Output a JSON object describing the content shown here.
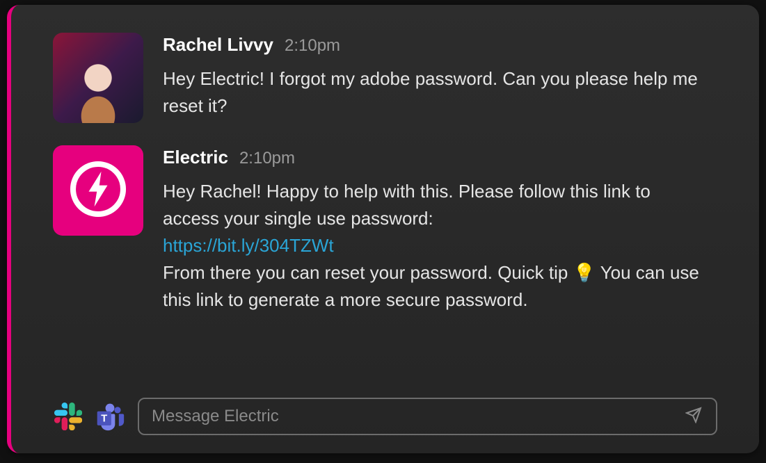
{
  "messages": [
    {
      "sender": "Rachel Livvy",
      "timestamp": "2:10pm",
      "avatar_kind": "user",
      "body": "Hey Electric! I forgot my adobe password. Can you please help me reset it?"
    },
    {
      "sender": "Electric",
      "timestamp": "2:10pm",
      "avatar_kind": "bot",
      "body_part1": "Hey Rachel! Happy to help with this. Please follow this link to access your single use password:",
      "link_text": "https://bit.ly/304TZWt",
      "body_part2": "From there you can reset your password. Quick tip ",
      "emoji": "💡",
      "body_part3": " You can use this link to generate a more secure password."
    }
  ],
  "composer": {
    "placeholder": "Message Electric"
  },
  "icons": {
    "slack": "slack-icon",
    "teams": "teams-icon",
    "send": "send-icon",
    "bolt": "electric-bolt-icon"
  },
  "colors": {
    "accent": "#e6007e",
    "link": "#2aa5d6",
    "bg": "#2a2a2a"
  }
}
